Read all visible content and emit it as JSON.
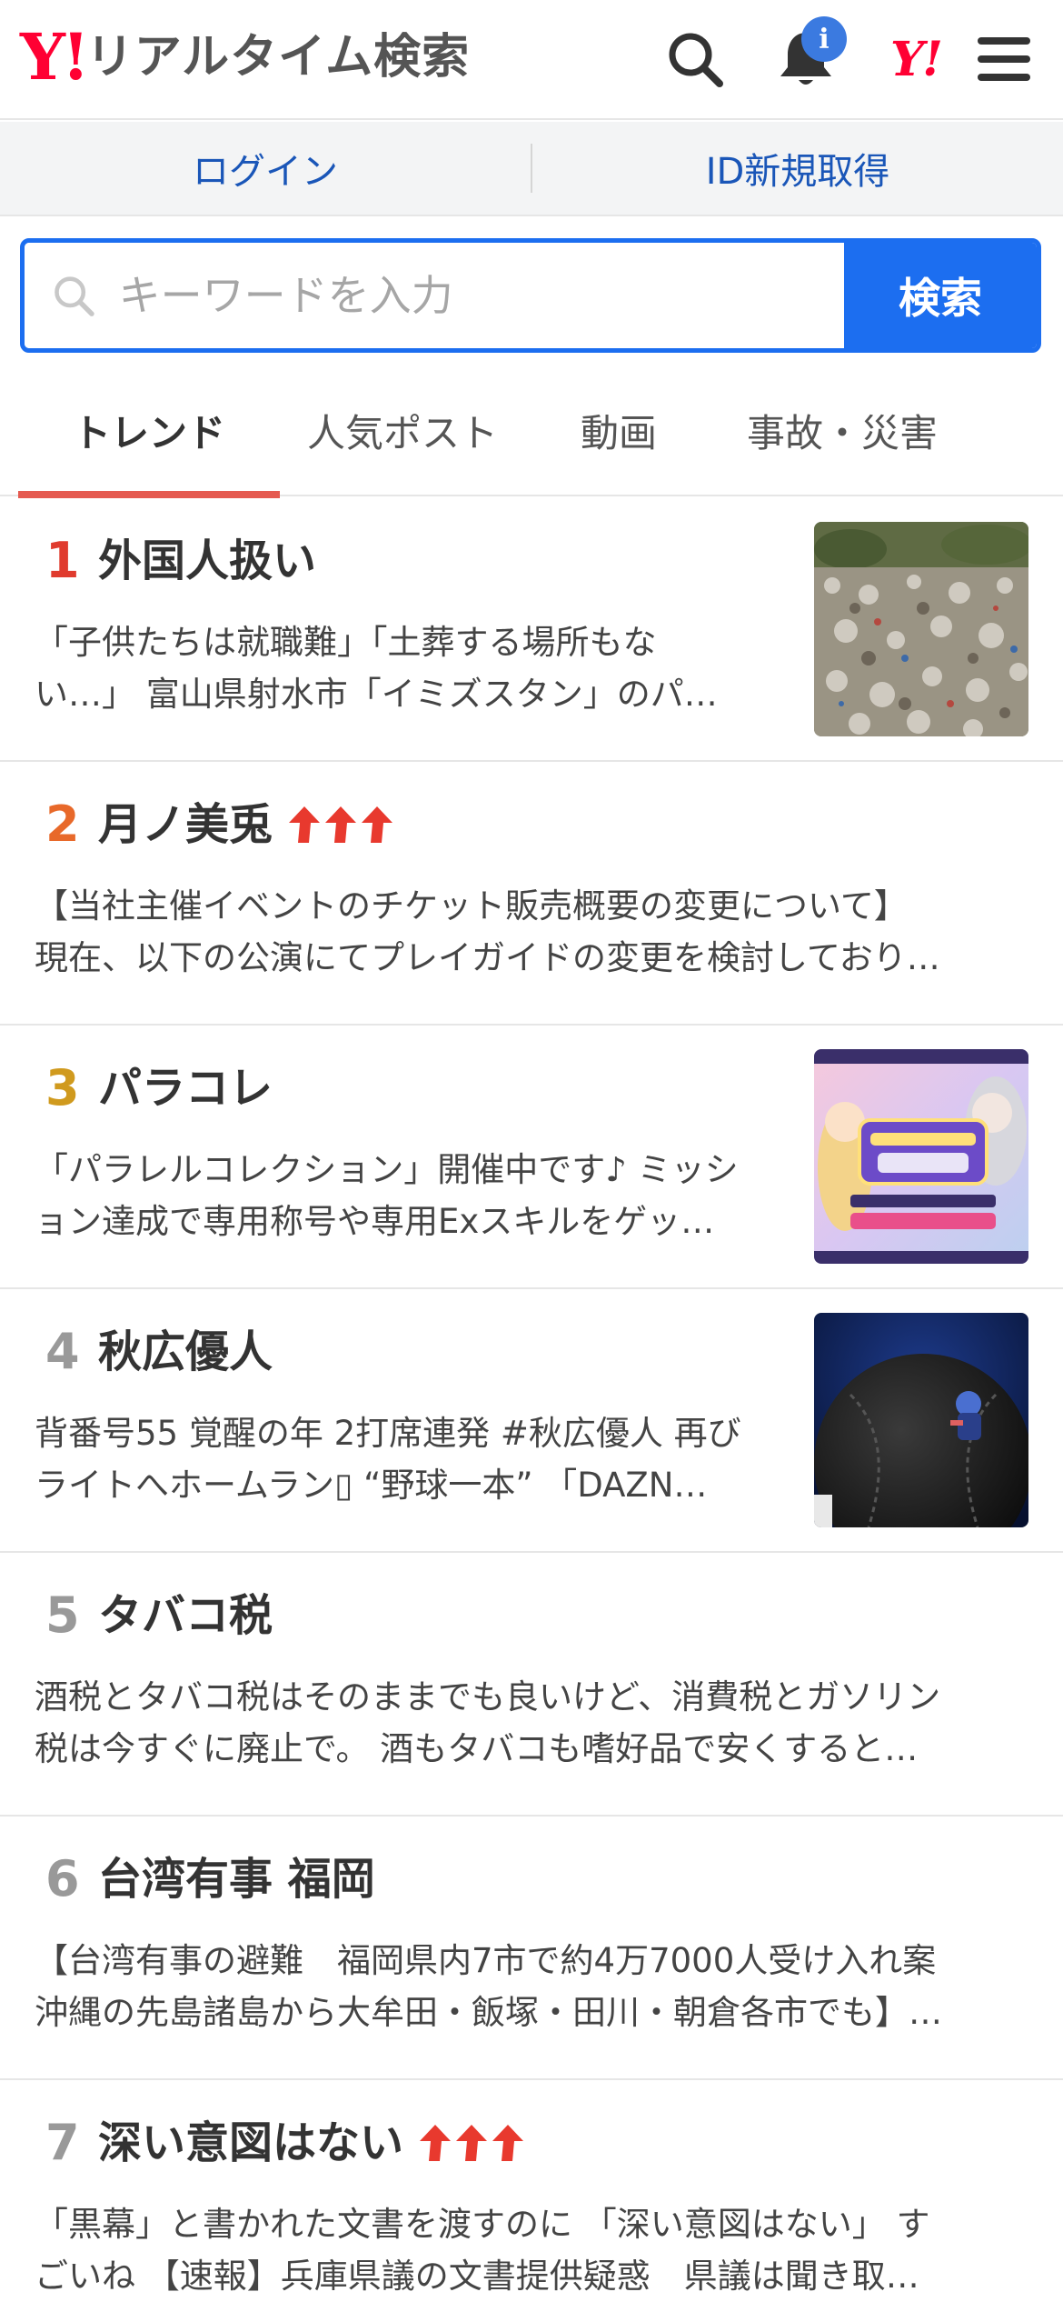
{
  "header": {
    "logo_mark": "Y!",
    "logo_text": "リアルタイム検索",
    "notification_badge": "i",
    "yj_mark": "Y!"
  },
  "auth": {
    "login": "ログイン",
    "register": "ID新規取得"
  },
  "search": {
    "placeholder": "キーワードを入力",
    "button": "検索"
  },
  "tabs": [
    {
      "label": "トレンド",
      "active": true
    },
    {
      "label": "人気ポスト",
      "active": false
    },
    {
      "label": "動画",
      "active": false
    },
    {
      "label": "事故・災害",
      "active": false
    }
  ],
  "colors": {
    "accent_blue": "#1c6ef0",
    "rank_1": "#e03b2e",
    "rank_2": "#e8692a",
    "rank_3": "#d09a1e",
    "rank_other": "#999999",
    "trend_arrow": "#e8392e",
    "tab_underline": "#e55a50"
  },
  "trends": [
    {
      "rank": "1",
      "title": "外国人扱い",
      "rising": false,
      "has_image": true,
      "image": "garbage-dump-photo",
      "desc_line1": "「子供たちは就職難」「土葬する場所もな",
      "desc_line2": "い…」 富山県射水市「イミズスタン」のパ…"
    },
    {
      "rank": "2",
      "title": "月ノ美兎",
      "rising": true,
      "has_image": false,
      "desc_line1": "【当社主催イベントのチケット販売概要の変更について】",
      "desc_line2": "現在、以下の公演にてプレイガイドの変更を検討しており…"
    },
    {
      "rank": "3",
      "title": "パラコレ",
      "rising": false,
      "has_image": true,
      "image": "parallel-collection-banner",
      "desc_line1": "「パラレルコレクション」開催中です♪ ミッシ",
      "desc_line2": "ョン達成で専用称号や専用Exスキルをゲッ…"
    },
    {
      "rank": "4",
      "title": "秋広優人",
      "rising": false,
      "has_image": true,
      "image": "baseball-photo",
      "desc_line1": "背番号55 覚醒の年 2打席連発 #秋広優人 再び",
      "desc_line2": "ライトへホームラン▯ “野球一本” 「DAZN…"
    },
    {
      "rank": "5",
      "title": "タバコ税",
      "rising": false,
      "has_image": false,
      "desc_line1": "酒税とタバコ税はそのままでも良いけど、消費税とガソリン",
      "desc_line2": "税は今すぐに廃止で。 酒もタバコも嗜好品で安くすると…"
    },
    {
      "rank": "6",
      "title": "台湾有事 福岡",
      "rising": false,
      "has_image": false,
      "desc_line1": "【台湾有事の避難　福岡県内7市で約4万7000人受け入れ案",
      "desc_line2": "沖縄の先島諸島から大牟田・飯塚・田川・朝倉各市でも】…"
    },
    {
      "rank": "7",
      "title": "深い意図はない",
      "rising": true,
      "has_image": false,
      "desc_line1": "「黒幕」と書かれた文書を渡すのに 「深い意図はない」 す",
      "desc_line2": "ごいね 【速報】兵庫県議の文書提供疑惑　県議は聞き取…"
    }
  ]
}
